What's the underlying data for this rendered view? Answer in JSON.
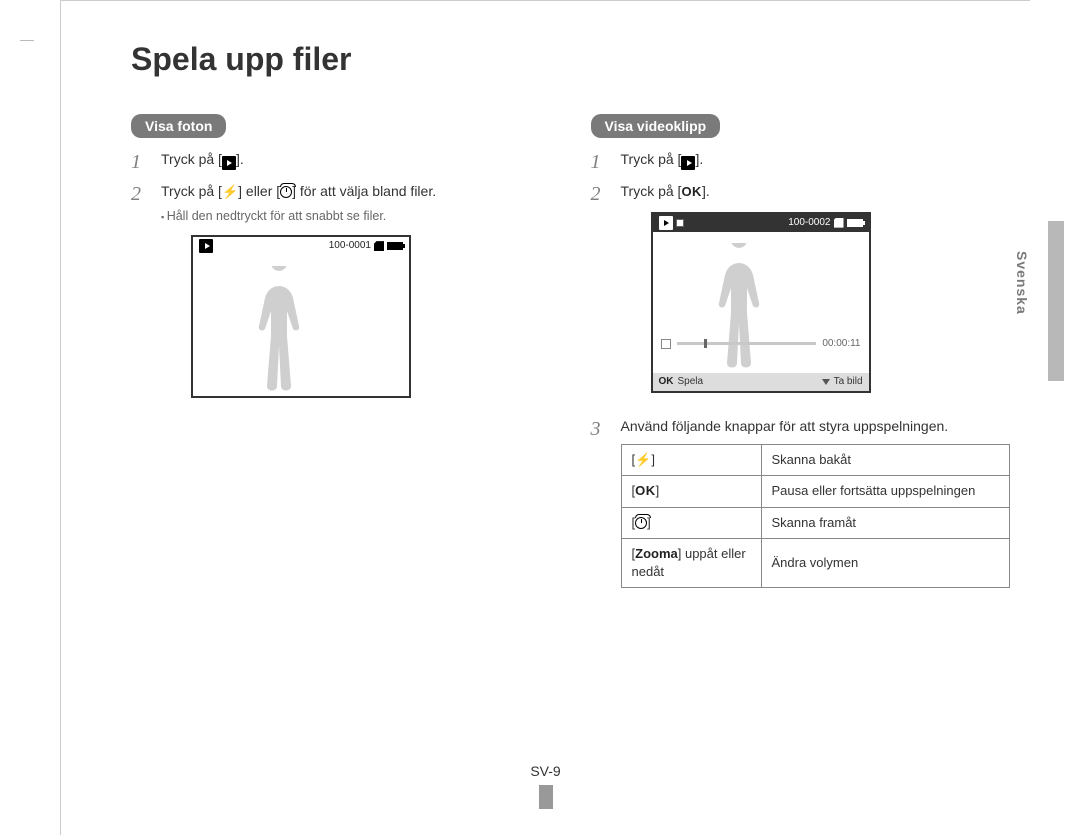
{
  "page": {
    "title": "Spela upp filer",
    "side_tab": "Svenska",
    "page_number": "SV-9"
  },
  "photos": {
    "label": "Visa foton",
    "step1_pre": "Tryck på [",
    "step1_post": "].",
    "step2_pre": "Tryck på [",
    "step2_mid": "] eller [",
    "step2_post": "] för att välja bland filer.",
    "substep": "Håll den nedtryckt för att snabbt se filer.",
    "screen_counter": "100-0001"
  },
  "videos": {
    "label": "Visa videoklipp",
    "step1_pre": "Tryck på [",
    "step1_post": "].",
    "step2_pre": "Tryck på [",
    "step2_post": "].",
    "step3": "Använd följande knappar för att styra uppspelningen.",
    "screen_counter": "100-0002",
    "screen_time": "00:00:11",
    "botbar_left": "Spela",
    "botbar_right": "Ta bild",
    "ok_label": "OK"
  },
  "icons": {
    "flash": "⚡",
    "ok": "OK"
  },
  "controls": [
    {
      "key_type": "flash",
      "desc": "Skanna bakåt"
    },
    {
      "key_type": "ok",
      "desc": "Pausa eller fortsätta uppspelningen"
    },
    {
      "key_type": "timer",
      "desc": "Skanna framåt"
    },
    {
      "key_type": "zoom",
      "key_bold": "Zooma",
      "key_rest": " uppåt eller nedåt",
      "desc": "Ändra volymen"
    }
  ]
}
